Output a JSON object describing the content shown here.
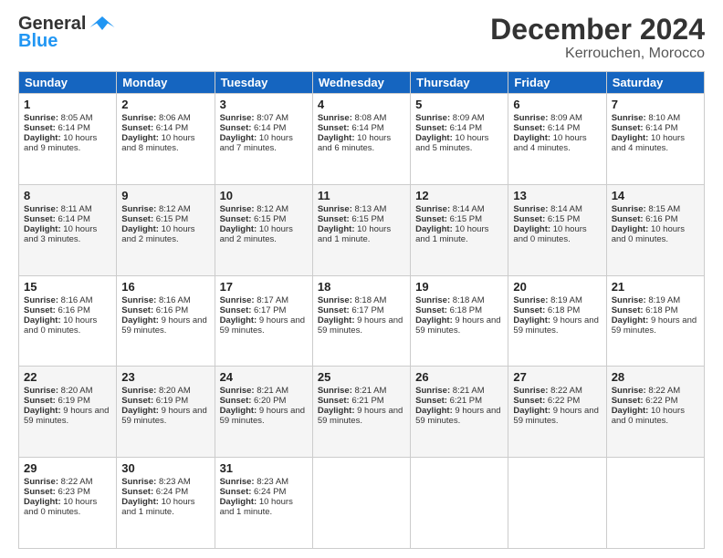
{
  "header": {
    "logo_general": "General",
    "logo_blue": "Blue",
    "month_title": "December 2024",
    "location": "Kerrouchen, Morocco"
  },
  "calendar": {
    "days": [
      "Sunday",
      "Monday",
      "Tuesday",
      "Wednesday",
      "Thursday",
      "Friday",
      "Saturday"
    ],
    "weeks": [
      [
        {
          "day": "1",
          "sunrise": "8:05 AM",
          "sunset": "6:14 PM",
          "daylight": "10 hours and 9 minutes."
        },
        {
          "day": "2",
          "sunrise": "8:06 AM",
          "sunset": "6:14 PM",
          "daylight": "10 hours and 8 minutes."
        },
        {
          "day": "3",
          "sunrise": "8:07 AM",
          "sunset": "6:14 PM",
          "daylight": "10 hours and 7 minutes."
        },
        {
          "day": "4",
          "sunrise": "8:08 AM",
          "sunset": "6:14 PM",
          "daylight": "10 hours and 6 minutes."
        },
        {
          "day": "5",
          "sunrise": "8:09 AM",
          "sunset": "6:14 PM",
          "daylight": "10 hours and 5 minutes."
        },
        {
          "day": "6",
          "sunrise": "8:09 AM",
          "sunset": "6:14 PM",
          "daylight": "10 hours and 4 minutes."
        },
        {
          "day": "7",
          "sunrise": "8:10 AM",
          "sunset": "6:14 PM",
          "daylight": "10 hours and 4 minutes."
        }
      ],
      [
        {
          "day": "8",
          "sunrise": "8:11 AM",
          "sunset": "6:14 PM",
          "daylight": "10 hours and 3 minutes."
        },
        {
          "day": "9",
          "sunrise": "8:12 AM",
          "sunset": "6:15 PM",
          "daylight": "10 hours and 2 minutes."
        },
        {
          "day": "10",
          "sunrise": "8:12 AM",
          "sunset": "6:15 PM",
          "daylight": "10 hours and 2 minutes."
        },
        {
          "day": "11",
          "sunrise": "8:13 AM",
          "sunset": "6:15 PM",
          "daylight": "10 hours and 1 minute."
        },
        {
          "day": "12",
          "sunrise": "8:14 AM",
          "sunset": "6:15 PM",
          "daylight": "10 hours and 1 minute."
        },
        {
          "day": "13",
          "sunrise": "8:14 AM",
          "sunset": "6:15 PM",
          "daylight": "10 hours and 0 minutes."
        },
        {
          "day": "14",
          "sunrise": "8:15 AM",
          "sunset": "6:16 PM",
          "daylight": "10 hours and 0 minutes."
        }
      ],
      [
        {
          "day": "15",
          "sunrise": "8:16 AM",
          "sunset": "6:16 PM",
          "daylight": "10 hours and 0 minutes."
        },
        {
          "day": "16",
          "sunrise": "8:16 AM",
          "sunset": "6:16 PM",
          "daylight": "9 hours and 59 minutes."
        },
        {
          "day": "17",
          "sunrise": "8:17 AM",
          "sunset": "6:17 PM",
          "daylight": "9 hours and 59 minutes."
        },
        {
          "day": "18",
          "sunrise": "8:18 AM",
          "sunset": "6:17 PM",
          "daylight": "9 hours and 59 minutes."
        },
        {
          "day": "19",
          "sunrise": "8:18 AM",
          "sunset": "6:18 PM",
          "daylight": "9 hours and 59 minutes."
        },
        {
          "day": "20",
          "sunrise": "8:19 AM",
          "sunset": "6:18 PM",
          "daylight": "9 hours and 59 minutes."
        },
        {
          "day": "21",
          "sunrise": "8:19 AM",
          "sunset": "6:18 PM",
          "daylight": "9 hours and 59 minutes."
        }
      ],
      [
        {
          "day": "22",
          "sunrise": "8:20 AM",
          "sunset": "6:19 PM",
          "daylight": "9 hours and 59 minutes."
        },
        {
          "day": "23",
          "sunrise": "8:20 AM",
          "sunset": "6:19 PM",
          "daylight": "9 hours and 59 minutes."
        },
        {
          "day": "24",
          "sunrise": "8:21 AM",
          "sunset": "6:20 PM",
          "daylight": "9 hours and 59 minutes."
        },
        {
          "day": "25",
          "sunrise": "8:21 AM",
          "sunset": "6:21 PM",
          "daylight": "9 hours and 59 minutes."
        },
        {
          "day": "26",
          "sunrise": "8:21 AM",
          "sunset": "6:21 PM",
          "daylight": "9 hours and 59 minutes."
        },
        {
          "day": "27",
          "sunrise": "8:22 AM",
          "sunset": "6:22 PM",
          "daylight": "9 hours and 59 minutes."
        },
        {
          "day": "28",
          "sunrise": "8:22 AM",
          "sunset": "6:22 PM",
          "daylight": "10 hours and 0 minutes."
        }
      ],
      [
        {
          "day": "29",
          "sunrise": "8:22 AM",
          "sunset": "6:23 PM",
          "daylight": "10 hours and 0 minutes."
        },
        {
          "day": "30",
          "sunrise": "8:23 AM",
          "sunset": "6:24 PM",
          "daylight": "10 hours and 1 minute."
        },
        {
          "day": "31",
          "sunrise": "8:23 AM",
          "sunset": "6:24 PM",
          "daylight": "10 hours and 1 minute."
        },
        null,
        null,
        null,
        null
      ]
    ],
    "labels": {
      "sunrise": "Sunrise:",
      "sunset": "Sunset:",
      "daylight": "Daylight:"
    }
  }
}
